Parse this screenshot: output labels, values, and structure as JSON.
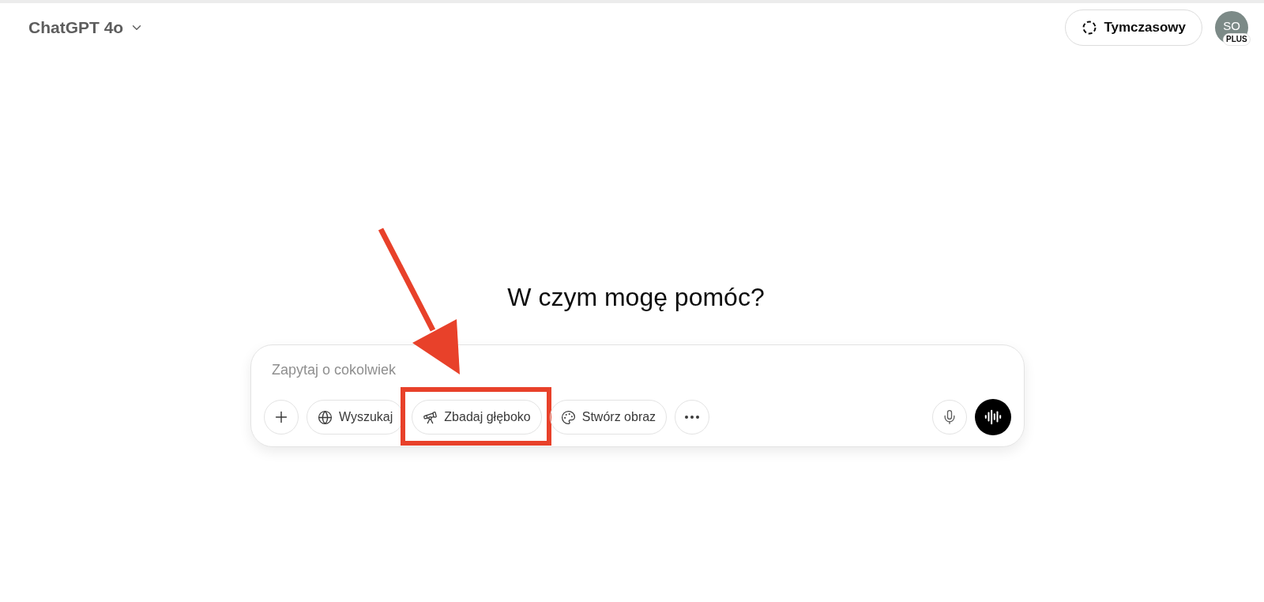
{
  "header": {
    "model_selector": "ChatGPT 4o",
    "temporary_button": "Tymczasowy",
    "avatar": {
      "initials": "SO",
      "badge": "PLUS"
    }
  },
  "heading": "W czym mogę pomóc?",
  "composer": {
    "placeholder": "Zapytaj o cokolwiek",
    "tools": [
      {
        "kind": "add",
        "highlighted": false
      },
      {
        "kind": "search",
        "label": "Wyszukaj",
        "highlighted": false
      },
      {
        "kind": "research",
        "label": "Zbadaj głęboko",
        "highlighted": true
      },
      {
        "kind": "image",
        "label": "Stwórz obraz",
        "highlighted": false
      },
      {
        "kind": "more",
        "highlighted": false
      }
    ]
  }
}
